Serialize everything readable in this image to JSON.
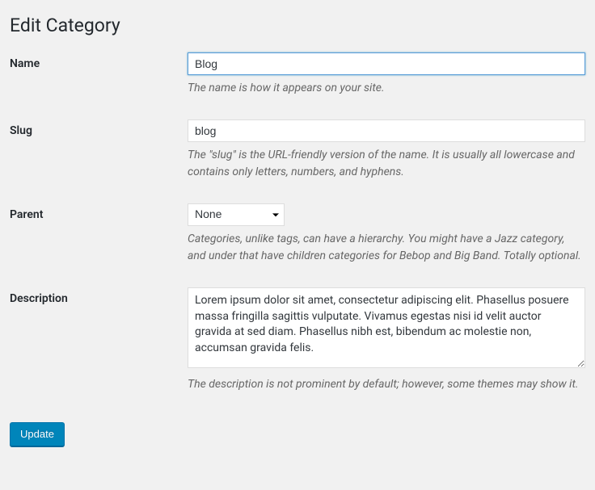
{
  "page": {
    "title": "Edit Category"
  },
  "fields": {
    "name": {
      "label": "Name",
      "value": "Blog",
      "description": "The name is how it appears on your site."
    },
    "slug": {
      "label": "Slug",
      "value": "blog",
      "description": "The \"slug\" is the URL-friendly version of the name. It is usually all lowercase and contains only letters, numbers, and hyphens."
    },
    "parent": {
      "label": "Parent",
      "selected": "None",
      "description": "Categories, unlike tags, can have a hierarchy. You might have a Jazz category, and under that have children categories for Bebop and Big Band. Totally optional."
    },
    "description": {
      "label": "Description",
      "value": "Lorem ipsum dolor sit amet, consectetur adipiscing elit. Phasellus posuere massa fringilla sagittis vulputate. Vivamus egestas nisi id velit auctor gravida at sed diam. Phasellus nibh est, bibendum ac molestie non, accumsan gravida felis.",
      "description": "The description is not prominent by default; however, some themes may show it."
    }
  },
  "actions": {
    "update_label": "Update"
  }
}
